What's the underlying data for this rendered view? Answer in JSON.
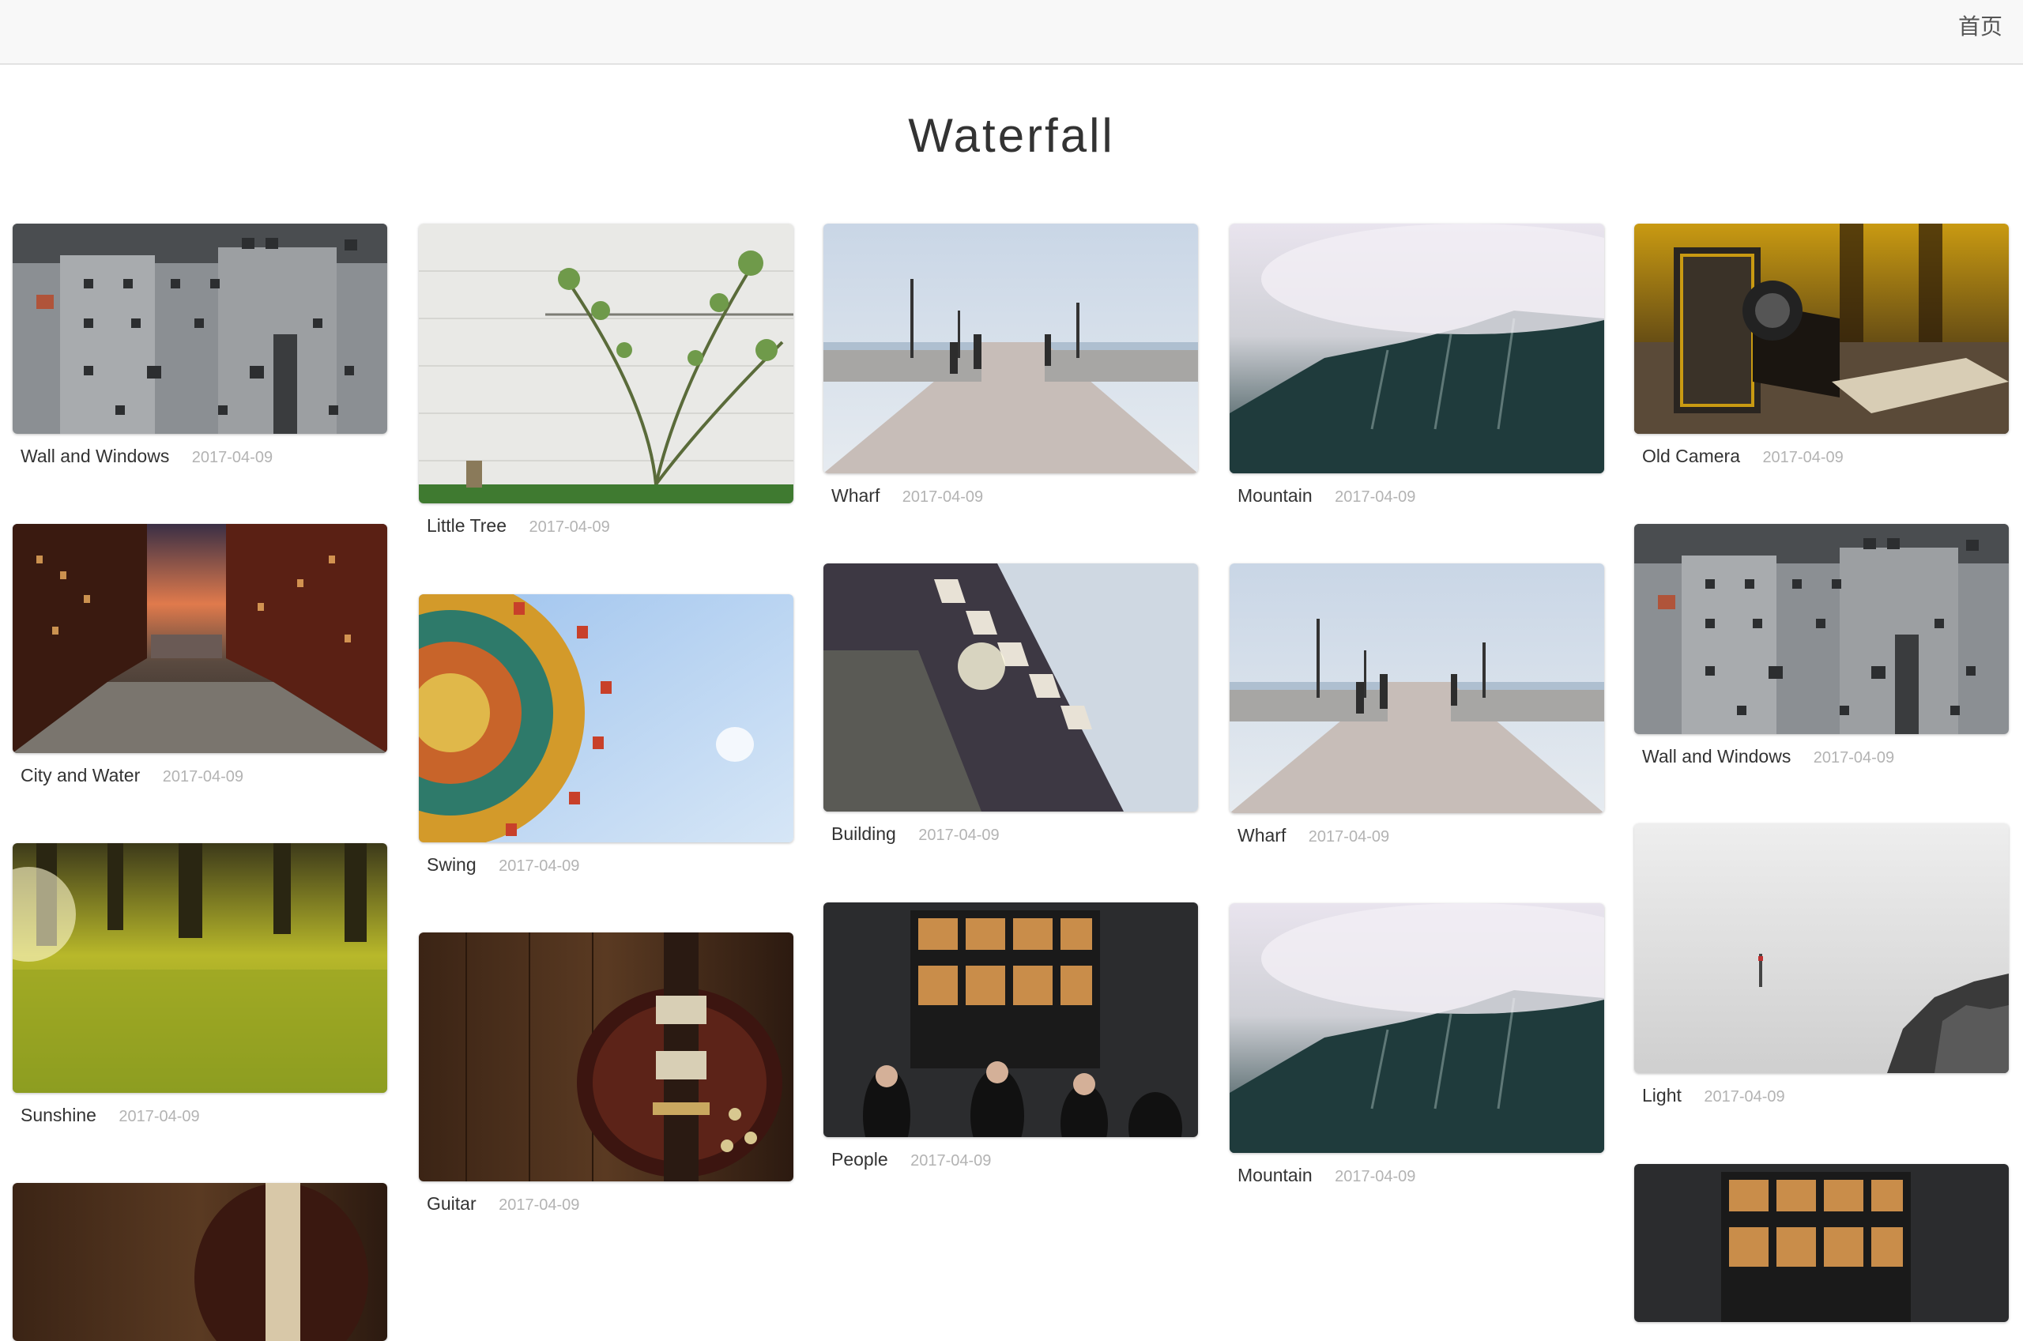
{
  "nav": {
    "home_label": "首页"
  },
  "page": {
    "title": "Waterfall"
  },
  "cards": [
    {
      "name": "Wall and Windows",
      "date": "2017-04-09",
      "image": "wall-and-windows"
    },
    {
      "name": "City and Water",
      "date": "2017-04-09",
      "image": "city-and-water"
    },
    {
      "name": "Sunshine",
      "date": "2017-04-09",
      "image": "sunshine"
    },
    {
      "name": "Little Tree",
      "date": "2017-04-09",
      "image": "little-tree"
    },
    {
      "name": "Swing",
      "date": "2017-04-09",
      "image": "swing"
    },
    {
      "name": "Guitar",
      "date": "2017-04-09",
      "image": "guitar"
    },
    {
      "name": "Wharf",
      "date": "2017-04-09",
      "image": "wharf"
    },
    {
      "name": "Building",
      "date": "2017-04-09",
      "image": "building"
    },
    {
      "name": "People",
      "date": "2017-04-09",
      "image": "people"
    },
    {
      "name": "Mountain",
      "date": "2017-04-09",
      "image": "mountain"
    },
    {
      "name": "Wharf",
      "date": "2017-04-09",
      "image": "wharf"
    },
    {
      "name": "Mountain",
      "date": "2017-04-09",
      "image": "mountain"
    },
    {
      "name": "Old Camera",
      "date": "2017-04-09",
      "image": "old-camera"
    },
    {
      "name": "Wall and Windows",
      "date": "2017-04-09",
      "image": "wall-and-windows"
    },
    {
      "name": "Light",
      "date": "2017-04-09",
      "image": "light"
    }
  ],
  "partial_cards": [
    {
      "image": "guitar"
    },
    {
      "image": "people"
    }
  ]
}
